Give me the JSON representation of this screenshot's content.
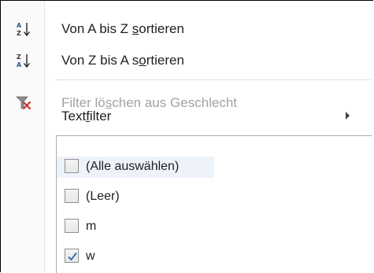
{
  "menu": {
    "sort_az": {
      "before": "Von A bis Z ",
      "accel": "s",
      "after": "ortieren",
      "icon": "sort-a-to-z-icon"
    },
    "sort_za": {
      "before": "Von Z bis A s",
      "accel": "o",
      "after": "rtieren",
      "icon": "sort-z-to-a-icon"
    },
    "clear_filter": {
      "before": "Filter lö",
      "accel": "s",
      "after": "chen aus Geschlecht",
      "icon": "clear-filter-icon",
      "disabled": true
    },
    "text_filter": {
      "before": "Text",
      "accel": "f",
      "after": "ilter",
      "icon": "submenu-arrow-icon"
    }
  },
  "filter_list": {
    "items": [
      {
        "label": "(Alle auswählen)",
        "checked": false
      },
      {
        "label": "(Leer)",
        "checked": false
      },
      {
        "label": "m",
        "checked": false
      },
      {
        "label": "w",
        "checked": true
      }
    ]
  },
  "colors": {
    "accent": "#2b579a",
    "clear_filter_red": "#d0312d",
    "disabled_text": "#a2a2a2",
    "check_blue": "#3f6fb4"
  }
}
